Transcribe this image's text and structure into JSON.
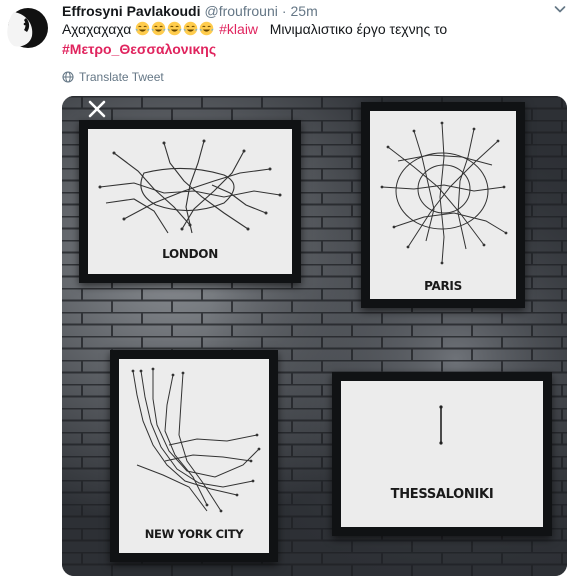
{
  "tweet": {
    "display_name": "Effrosyni Pavlakoudi",
    "handle": "@froufrouni",
    "separator": "·",
    "time": "25m",
    "text_prefix": "Αχαχαχαχα",
    "emoji_name": "face-with-tears-of-joy",
    "emoji_count": 5,
    "hashtag_1": "#klaiw",
    "text_middle": "Μινιμαλιστικο έργο τεχνης το",
    "hashtag_2": "#Μετρο_Θεσσαλονικης",
    "translate_label": "Translate Tweet"
  },
  "media": {
    "panels": [
      {
        "city": "LONDON"
      },
      {
        "city": "PARIS"
      },
      {
        "city": "NEW YORK CITY"
      },
      {
        "city": "THESSALONIKI"
      }
    ]
  },
  "colors": {
    "hashtag": "#e0245e",
    "muted": "#657786",
    "text": "#14171a"
  }
}
